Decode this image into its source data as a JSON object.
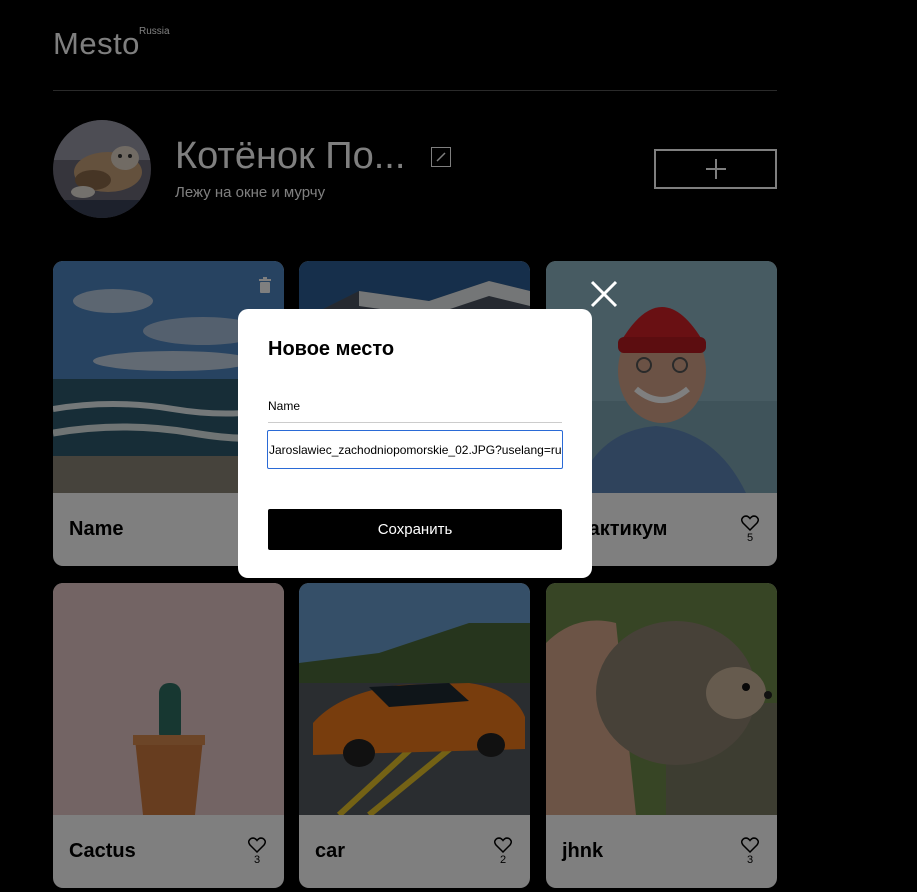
{
  "header": {
    "logo": "Mesto",
    "logo_sup": "Russia"
  },
  "profile": {
    "name": "Котёнок По...",
    "about": "Лежу на окне и мурчу"
  },
  "cards": [
    {
      "title": "Name",
      "likes": "",
      "has_trash": true
    },
    {
      "title": "",
      "likes": ""
    },
    {
      "title": "Практикум",
      "likes": "5"
    },
    {
      "title": "Cactus",
      "likes": "3"
    },
    {
      "title": "car",
      "likes": "2"
    },
    {
      "title": "jhnk",
      "likes": "3"
    }
  ],
  "modal": {
    "title": "Новое место",
    "name_label": "Name",
    "link_value": "Jaroslawiec_zachodniopomorskie_02.JPG?uselang=ru",
    "save_label": "Сохранить"
  },
  "icons": {
    "edit": "pencil-icon",
    "add": "plus-icon",
    "like": "heart-outline-icon",
    "trash": "trash-icon",
    "close": "close-icon"
  },
  "colors": {
    "background": "#000000",
    "overlay": "rgba(0,0,0,0.5)",
    "input_focus": "#2a6ad6"
  }
}
